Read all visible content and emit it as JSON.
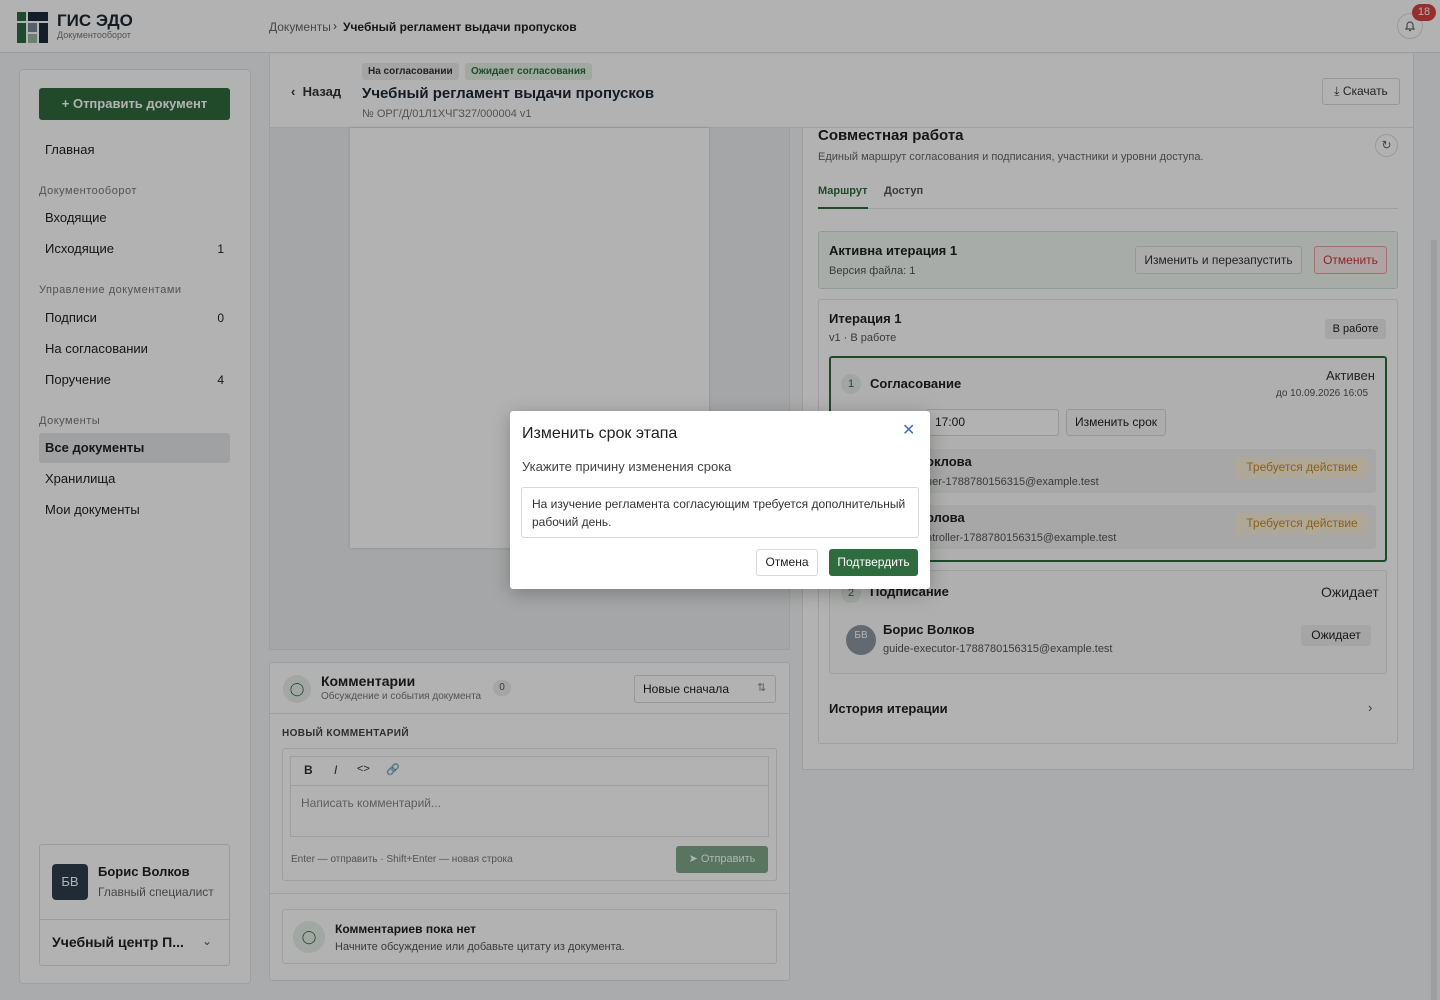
{
  "app": {
    "name": "ГИС ЭДО",
    "subtitle": "Документооборот"
  },
  "breadcrumb": {
    "root": "Документы",
    "separator": "›",
    "current": "Учебный регламент выдачи пропусков"
  },
  "notifications": {
    "count": "18"
  },
  "sidebar": {
    "send_button": "+ Отправить документ",
    "home": "Главная",
    "groups": {
      "docflow": "Документооборот",
      "management": "Управление документами",
      "documents": "Документы"
    },
    "items": {
      "incoming": {
        "label": "Входящие",
        "count": ""
      },
      "outgoing": {
        "label": "Исходящие",
        "count": "1"
      },
      "signatures": {
        "label": "Подписи",
        "count": "0"
      },
      "approval": {
        "label": "На согласовании",
        "count": ""
      },
      "assignment": {
        "label": "Поручение",
        "count": "4"
      },
      "all_docs": {
        "label": "Все документы"
      },
      "storage": {
        "label": "Хранилища"
      },
      "my_docs": {
        "label": "Мои документы"
      }
    },
    "user": {
      "initials": "БВ",
      "name": "Борис Волков",
      "role": "Главный специалист",
      "org": "Учебный центр П..."
    }
  },
  "document": {
    "back": "Назад",
    "badges": [
      "На согласовании",
      "Ожидает согласования"
    ],
    "title": "Учебный регламент выдачи пропусков",
    "number": "№ ОРГ/Д/01Л1ХЧГЗ27/000004  v1",
    "download": "Скачать"
  },
  "comments": {
    "title": "Комментарии",
    "subtitle": "Обсуждение и события документа",
    "count": "0",
    "sort": "Новые сначала",
    "new_label": "НОВЫЙ КОММЕНТАРИЙ",
    "toolbar": {
      "bold": "B",
      "italic": "I",
      "code": "<>",
      "link": "🔗"
    },
    "placeholder": "Написать комментарий...",
    "hint": "Enter — отправить · Shift+Enter — новая строка",
    "send": "Отправить",
    "empty_title": "Комментариев пока нет",
    "empty_sub": "Начните обсуждение или добавьте цитату из документа."
  },
  "collab": {
    "title": "Совместная работа",
    "subtitle": "Единый маршрут согласования и подписания, участники и уровни доступа.",
    "tabs": [
      "Маршрут",
      "Доступ"
    ],
    "active_iteration": {
      "title": "Активна итерация 1",
      "sub": "Версия файла: 1",
      "restart": "Изменить и перезапустить",
      "cancel": "Отменить"
    },
    "iteration": {
      "title": "Итерация 1",
      "sub": "v1 · В работе",
      "status": "В работе"
    },
    "stage1": {
      "num": "1",
      "name": "Согласование",
      "status": "Активен",
      "deadline": "до 10.09.2026 16:05",
      "time_value": "17:00",
      "change_btn": "Изменить срок",
      "people": [
        {
          "name": "оклова",
          "mail": "uer-1788780156315@example.test",
          "status": "Требуется действие"
        },
        {
          "name": "рлова",
          "mail": "ntroller-1788780156315@example.test",
          "status": "Требуется действие"
        }
      ]
    },
    "stage2": {
      "num": "2",
      "name": "Подписание",
      "status": "Ожидает",
      "person": {
        "initials": "БВ",
        "name": "Борис Волков",
        "mail": "guide-executor-1788780156315@example.test",
        "status": "Ожидает"
      }
    },
    "history": "История итерации"
  },
  "modal": {
    "title": "Изменить срок этапа",
    "label": "Укажите причину изменения срока",
    "text": "На изучение регламента согласующим требуется дополнительный рабочий день.",
    "cancel": "Отмена",
    "confirm": "Подтвердить"
  }
}
